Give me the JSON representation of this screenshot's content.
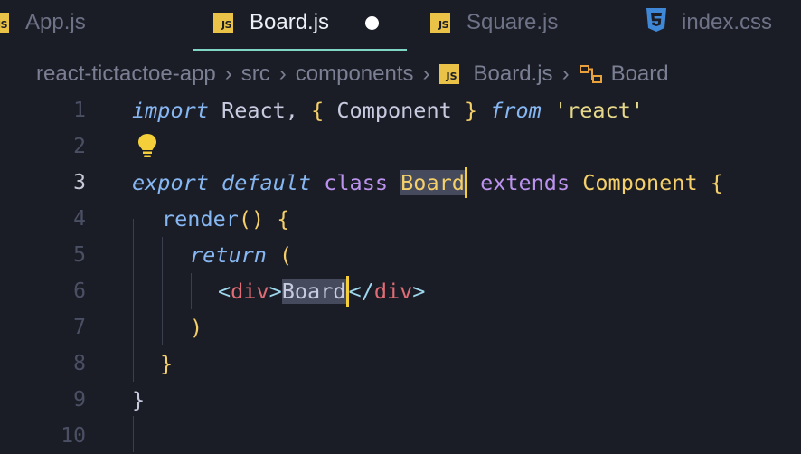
{
  "tabs": [
    {
      "label": "App.js",
      "icon": "js-icon",
      "active": false
    },
    {
      "label": "Board.js",
      "icon": "js-icon",
      "active": true,
      "dirty": true
    },
    {
      "label": "Square.js",
      "icon": "js-icon",
      "active": false
    },
    {
      "label": "index.css",
      "icon": "css-icon",
      "active": false
    }
  ],
  "breadcrumb": {
    "items": [
      "react-tictactoe-app",
      "src",
      "components",
      "Board.js",
      "Board"
    ],
    "icon_badge": "JS"
  },
  "editor": {
    "line_numbers": [
      "1",
      "2",
      "3",
      "4",
      "5",
      "6",
      "7",
      "8",
      "9",
      "10"
    ],
    "current_line": "3",
    "tokens": {
      "import": "import",
      "react_ident": "React,",
      "lbrace": "{",
      "component": "Component",
      "rbrace": "}",
      "from": "from",
      "react_str": "'react'",
      "export": "export",
      "default": "default",
      "class": "class",
      "board": "Board",
      "extends": "extends",
      "component2": "Component",
      "open_brace": "{",
      "render": "render",
      "parens": "()",
      "render_brace": "{",
      "return": "return",
      "return_paren": "(",
      "lt": "<",
      "div_open": "div",
      "gt": ">",
      "board_text": "Board",
      "lt_slash": "</",
      "div_close": "div",
      "gt_close": ">",
      "close_paren": ")",
      "close_render": "}",
      "close_class": "}"
    }
  },
  "colors": {
    "background": "#1b1d26",
    "accent_underline": "#7fd6c4",
    "js_badge": "#e9c247",
    "css_icon": "#3f88d8",
    "cursor": "#f4cf3a"
  }
}
